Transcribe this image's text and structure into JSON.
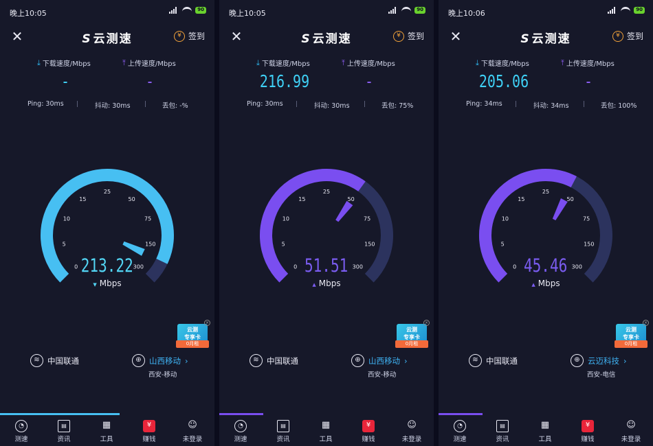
{
  "panels": [
    {
      "status": {
        "time": "晚上10:05",
        "battery": "90"
      },
      "header": {
        "close_icon": "close-icon",
        "logo": "云测速",
        "signin_label": "签到",
        "coin_glyph": "¥"
      },
      "speed_labels": {
        "download": "下载速度/Mbps",
        "upload": "上传速度/Mbps"
      },
      "speed_values": {
        "download": "-",
        "upload": "-"
      },
      "stats": {
        "ping": "Ping: 30ms",
        "jitter": "抖动: 30ms",
        "loss": "丢包: -%"
      },
      "gauge": {
        "value": 213.22,
        "ticks": [
          "0",
          "5",
          "10",
          "15",
          "25",
          "50",
          "75",
          "150",
          "300"
        ],
        "phase": "download",
        "arc_color": "#47bff2",
        "needle_color": "#47bff2"
      },
      "reading": {
        "value": "213.22",
        "unit": "Mbps",
        "color": "#53d6f5"
      },
      "ad": {
        "line1": "云测",
        "line2": "专享卡",
        "strip": "0月租"
      },
      "network": {
        "isp": "中国联通",
        "server": "山西移动",
        "server_location": "西安-移动"
      },
      "tabs": [
        "测速",
        "资讯",
        "工具",
        "赚钱",
        "未登录"
      ]
    },
    {
      "status": {
        "time": "晚上10:05",
        "battery": "90"
      },
      "header": {
        "close_icon": "close-icon",
        "logo": "云测速",
        "signin_label": "签到",
        "coin_glyph": "¥"
      },
      "speed_labels": {
        "download": "下载速度/Mbps",
        "upload": "上传速度/Mbps"
      },
      "speed_values": {
        "download": "216.99",
        "upload": "-"
      },
      "stats": {
        "ping": "Ping: 30ms",
        "jitter": "抖动: 30ms",
        "loss": "丢包: 75%"
      },
      "gauge": {
        "value": 51.51,
        "ticks": [
          "0",
          "5",
          "10",
          "15",
          "25",
          "50",
          "75",
          "150",
          "300"
        ],
        "phase": "upload",
        "arc_color": "#7a4ef0",
        "needle_color": "#7a4ef0"
      },
      "reading": {
        "value": "51.51",
        "unit": "Mbps",
        "color": "#7a5cf0"
      },
      "ad": {
        "line1": "云测",
        "line2": "专享卡",
        "strip": "0月租"
      },
      "network": {
        "isp": "中国联通",
        "server": "山西移动",
        "server_location": "西安-移动"
      },
      "tabs": [
        "测速",
        "资讯",
        "工具",
        "赚钱",
        "未登录"
      ]
    },
    {
      "status": {
        "time": "晚上10:06",
        "battery": "90"
      },
      "header": {
        "close_icon": "close-icon",
        "logo": "云测速",
        "signin_label": "签到",
        "coin_glyph": "¥"
      },
      "speed_labels": {
        "download": "下载速度/Mbps",
        "upload": "上传速度/Mbps"
      },
      "speed_values": {
        "download": "205.06",
        "upload": "-"
      },
      "stats": {
        "ping": "Ping: 34ms",
        "jitter": "抖动: 34ms",
        "loss": "丢包: 100%"
      },
      "gauge": {
        "value": 45.46,
        "ticks": [
          "0",
          "5",
          "10",
          "15",
          "25",
          "50",
          "75",
          "150",
          "300"
        ],
        "phase": "upload",
        "arc_color": "#7a4ef0",
        "needle_color": "#7a4ef0"
      },
      "reading": {
        "value": "45.46",
        "unit": "Mbps",
        "color": "#7a5cf0"
      },
      "ad": {
        "line1": "云测",
        "line2": "专享卡",
        "strip": "0月租"
      },
      "network": {
        "isp": "中国联通",
        "server": "云迈科技",
        "server_location": "西安-电信"
      },
      "tabs": [
        "测速",
        "资讯",
        "工具",
        "赚钱",
        "未登录"
      ]
    }
  ]
}
